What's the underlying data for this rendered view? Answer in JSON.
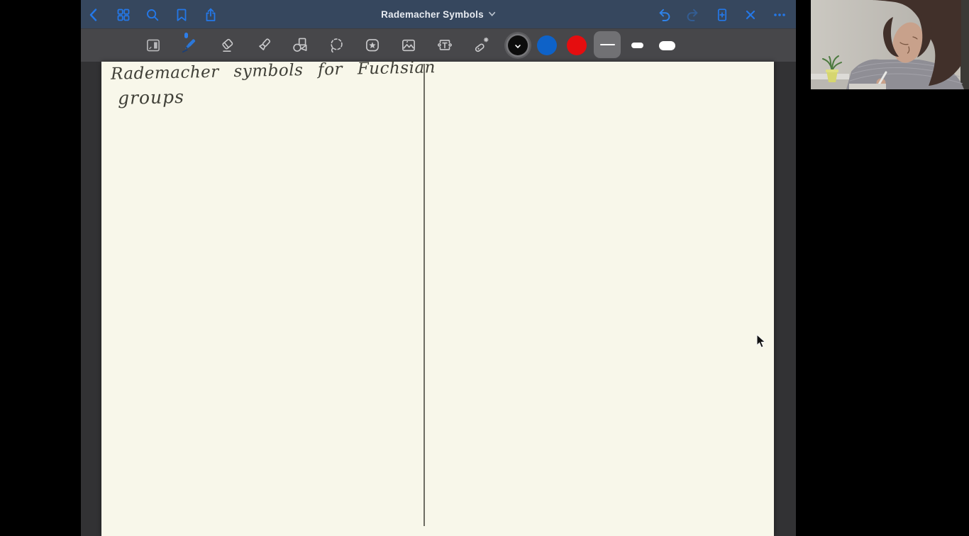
{
  "titlebar": {
    "title": "Rademacher Symbols",
    "left_buttons": [
      "back",
      "document-grid",
      "search",
      "bookmark",
      "share"
    ],
    "right_buttons": [
      "undo",
      "redo",
      "add-page",
      "close",
      "more"
    ],
    "redo_enabled": false
  },
  "toolbar": {
    "tools": [
      {
        "id": "page-sidebar",
        "selected": false
      },
      {
        "id": "pen",
        "selected": true
      },
      {
        "id": "eraser",
        "selected": false
      },
      {
        "id": "highlighter",
        "selected": false
      },
      {
        "id": "shapes",
        "selected": false
      },
      {
        "id": "lasso",
        "selected": false
      },
      {
        "id": "elements",
        "selected": false
      },
      {
        "id": "image",
        "selected": false
      },
      {
        "id": "text",
        "selected": false
      },
      {
        "id": "laser-pointer",
        "selected": false
      }
    ],
    "ink_colors": [
      {
        "id": "black",
        "hex": "#0c0c0c",
        "selected": true
      },
      {
        "id": "blue",
        "hex": "#0e62c8",
        "selected": false
      },
      {
        "id": "red",
        "hex": "#e50d0f",
        "selected": false
      }
    ],
    "stroke_widths": [
      {
        "id": "thin",
        "selected": true
      },
      {
        "id": "medium",
        "selected": false
      },
      {
        "id": "thick",
        "selected": false
      }
    ]
  },
  "page": {
    "handwriting_line1": "Rademacher symbols for Fuchsian",
    "handwriting_line2": "groups",
    "has_vertical_divider": true
  },
  "webcam": {
    "content": "presenter looking down writing, plant on shelf at left"
  },
  "colors": {
    "titlebar_bg": "#36475e",
    "toolbar_bg": "#47474a",
    "canvas_bg": "#323234",
    "paper_bg": "#f8f7ea",
    "accent_blue": "#2478e8",
    "tool_icon_gray": "#c9c9cb"
  }
}
